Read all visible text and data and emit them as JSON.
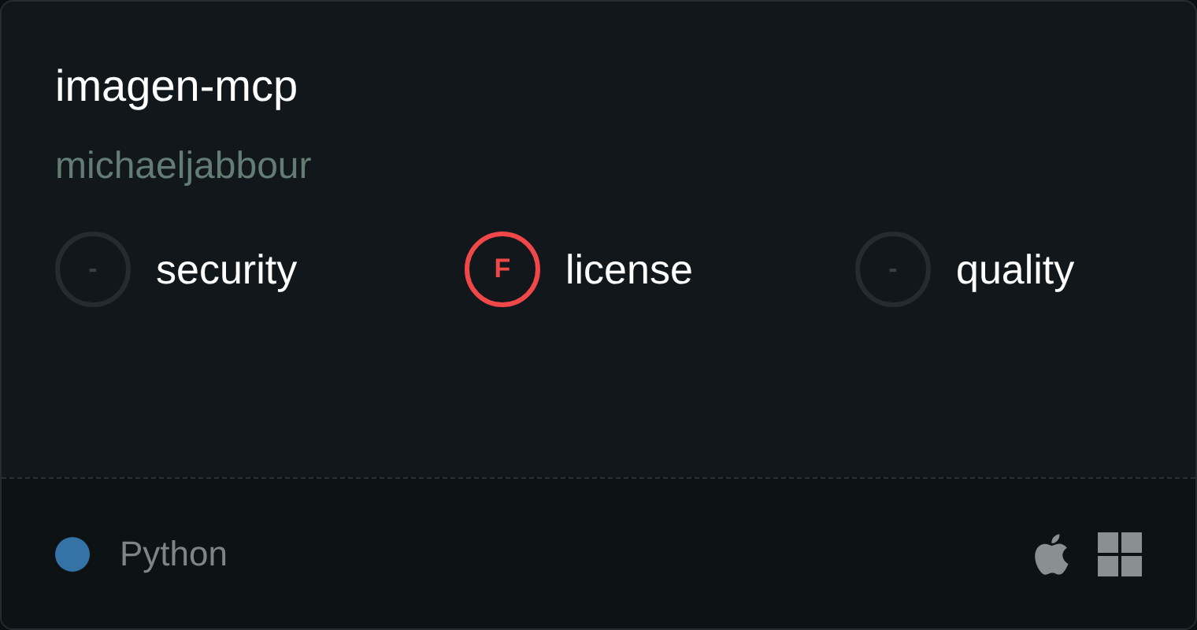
{
  "title": "imagen-mcp",
  "owner": "michaeljabbour",
  "scores": [
    {
      "grade": "-",
      "label": "security",
      "color": "#262b2e"
    },
    {
      "grade": "F",
      "label": "license",
      "color": "#f04848"
    },
    {
      "grade": "-",
      "label": "quality",
      "color": "#262b2e"
    }
  ],
  "language": {
    "name": "Python",
    "color": "#3572a5"
  },
  "platforms": [
    {
      "kind": "apple"
    },
    {
      "kind": "windows"
    }
  ]
}
